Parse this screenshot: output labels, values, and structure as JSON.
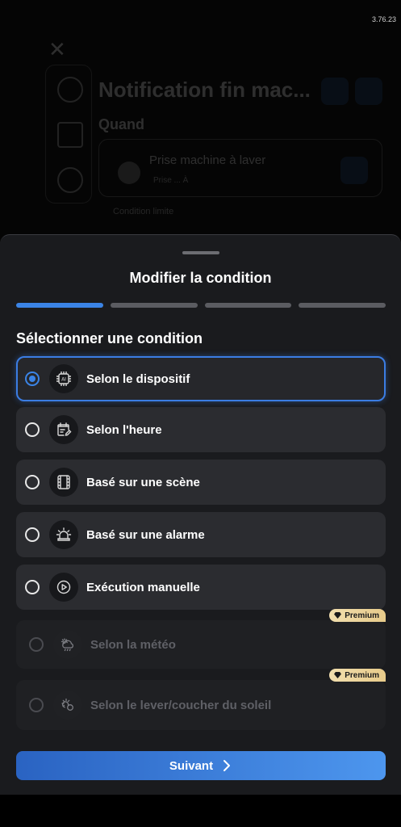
{
  "status": {
    "version": "3.76.23"
  },
  "background": {
    "title": "Notification fin mac...",
    "section": "Quand",
    "card_title": "Prise machine à laver",
    "card_subtitle": "Prise ... À",
    "add_label": "Condition limite"
  },
  "sheet": {
    "title": "Modifier la condition",
    "steps": [
      {
        "active": true
      },
      {
        "active": false
      },
      {
        "active": false
      },
      {
        "active": false
      }
    ],
    "section_label": "Sélectionner une condition",
    "options": [
      {
        "label": "Selon le dispositif",
        "icon": "chip-ai-icon",
        "selected": true,
        "disabled": false
      },
      {
        "label": "Selon l'heure",
        "icon": "calendar-edit-icon",
        "selected": false,
        "disabled": false
      },
      {
        "label": "Basé sur une scène",
        "icon": "film-icon",
        "selected": false,
        "disabled": false
      },
      {
        "label": "Basé sur une alarme",
        "icon": "siren-icon",
        "selected": false,
        "disabled": false
      },
      {
        "label": "Exécution manuelle",
        "icon": "play-circle-icon",
        "selected": false,
        "disabled": false
      },
      {
        "label": "Selon la météo",
        "icon": "weather-icon",
        "selected": false,
        "disabled": true,
        "badge": "Premium"
      },
      {
        "label": "Selon le lever/coucher du soleil",
        "icon": "sunrise-icon",
        "selected": false,
        "disabled": true,
        "badge": "Premium"
      }
    ],
    "next_label": "Suivant"
  },
  "colors": {
    "accent": "#3b84e6",
    "sheet_bg": "#1a1b1e",
    "option_bg": "#2b2c30",
    "premium": "#ecd49b"
  }
}
